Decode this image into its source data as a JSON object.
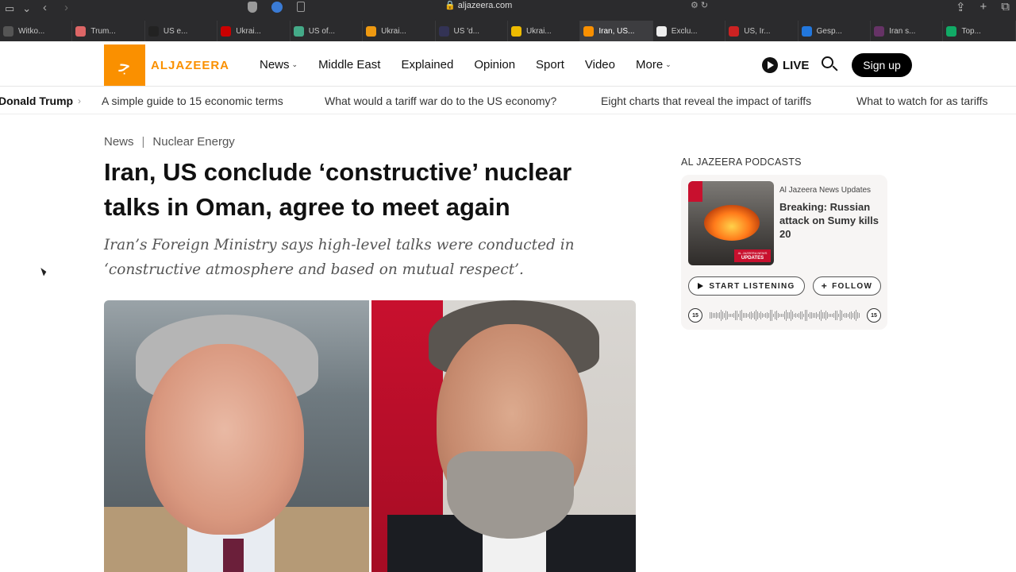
{
  "browser": {
    "address": "aljazeera.com",
    "tabs": [
      {
        "label": "Witko...",
        "color": "#555"
      },
      {
        "label": "Trum...",
        "color": "#d66"
      },
      {
        "label": "US e...",
        "color": "#222"
      },
      {
        "label": "Ukrai...",
        "color": "#c00"
      },
      {
        "label": "US of...",
        "color": "#4a8"
      },
      {
        "label": "Ukrai...",
        "color": "#e91"
      },
      {
        "label": "US 'd...",
        "color": "#335"
      },
      {
        "label": "Ukrai...",
        "color": "#eb0"
      },
      {
        "label": "Iran, US...",
        "color": "#fa9000"
      },
      {
        "label": "Exclu...",
        "color": "#eee"
      },
      {
        "label": "US, Ir...",
        "color": "#c22"
      },
      {
        "label": "Gesp...",
        "color": "#27d"
      },
      {
        "label": "Iran s...",
        "color": "#636"
      },
      {
        "label": "Top...",
        "color": "#1a6"
      }
    ]
  },
  "header": {
    "logo_text": "ALJAZEERA",
    "nav": [
      {
        "label": "News",
        "dropdown": true
      },
      {
        "label": "Middle East",
        "dropdown": false
      },
      {
        "label": "Explained",
        "dropdown": false
      },
      {
        "label": "Opinion",
        "dropdown": false
      },
      {
        "label": "Sport",
        "dropdown": false
      },
      {
        "label": "Video",
        "dropdown": false
      },
      {
        "label": "More",
        "dropdown": true
      }
    ],
    "live_label": "LIVE",
    "signup_label": "Sign up"
  },
  "trending": {
    "first": "Donald Trump",
    "items": [
      "A simple guide to 15 economic terms",
      "What would a tariff war do to the US economy?",
      "Eight charts that reveal the impact of tariffs",
      "What to watch for as tariffs"
    ]
  },
  "article": {
    "breadcrumb": [
      "News",
      "Nuclear Energy"
    ],
    "breadcrumb_sep": "|",
    "headline": "Iran, US conclude ‘constructive’ nuclear talks in Oman, agree to meet again",
    "standfirst": "Iran’s Foreign Ministry says high-level talks were conducted in ‘constructive atmosphere and based on mutual respect’."
  },
  "podcast": {
    "heading": "AL JAZEERA PODCASTS",
    "show": "Al Jazeera News Updates",
    "title": "Breaking: Russian attack on Sumy kills 20",
    "thumb_label": "UPDATES",
    "thumb_label_sub": "AL JAZEERA NEWS",
    "listen_label": "START LISTENING",
    "follow_label": "FOLLOW",
    "skip_seconds": "15"
  },
  "colors": {
    "brand": "#fa9000"
  }
}
